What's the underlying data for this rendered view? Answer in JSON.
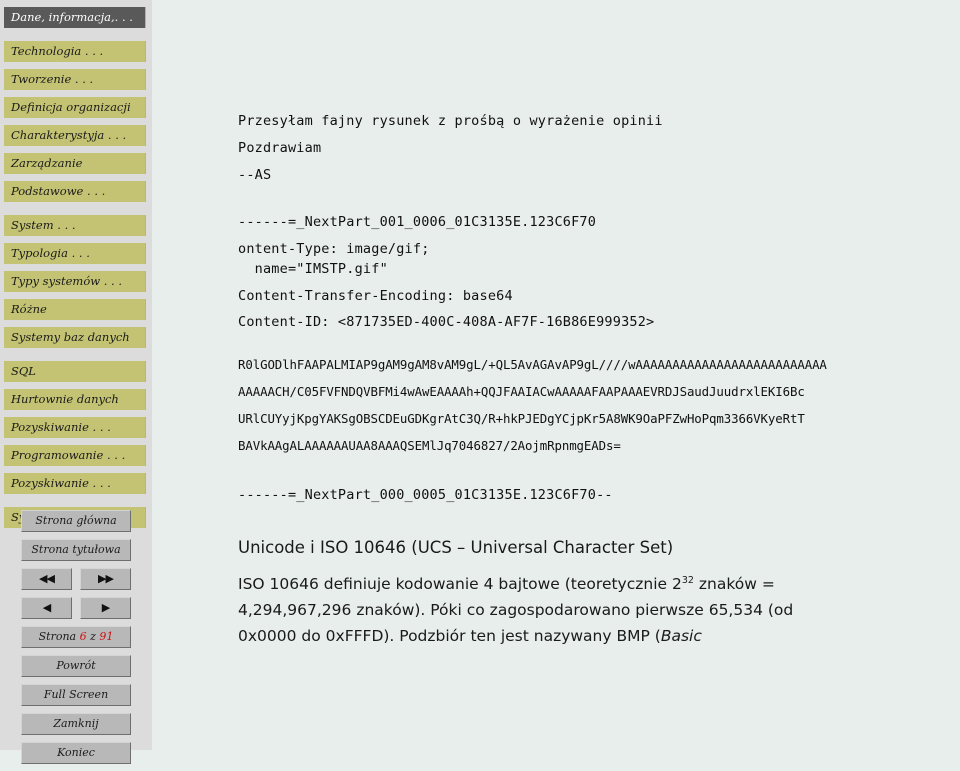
{
  "sidebar": {
    "items": [
      {
        "label": "Dane, informacja,. . .",
        "active": true,
        "gap": "sm"
      },
      {
        "label": "Technologia . . .",
        "active": false,
        "gap": "md"
      },
      {
        "label": "Tworzenie . . .",
        "active": false,
        "gap": "sm"
      },
      {
        "label": "Definicja organizacji",
        "active": false,
        "gap": "sm"
      },
      {
        "label": "Charakterystyja . . .",
        "active": false,
        "gap": "sm"
      },
      {
        "label": "Zarządzanie",
        "active": false,
        "gap": "sm"
      },
      {
        "label": "Podstawowe . . .",
        "active": false,
        "gap": "sm"
      },
      {
        "label": "System . . .",
        "active": false,
        "gap": "md"
      },
      {
        "label": "Typologia . . .",
        "active": false,
        "gap": "sm"
      },
      {
        "label": "Typy systemów . . .",
        "active": false,
        "gap": "sm"
      },
      {
        "label": "Różne",
        "active": false,
        "gap": "sm"
      },
      {
        "label": "Systemy baz danych",
        "active": false,
        "gap": "sm"
      },
      {
        "label": "SQL",
        "active": false,
        "gap": "md"
      },
      {
        "label": "Hurtownie danych",
        "active": false,
        "gap": "sm"
      },
      {
        "label": "Pozyskiwanie . . .",
        "active": false,
        "gap": "sm"
      },
      {
        "label": "Programowanie . . .",
        "active": false,
        "gap": "sm"
      },
      {
        "label": "Pozyskiwanie . . .",
        "active": false,
        "gap": "sm"
      },
      {
        "label": "System . . .",
        "active": false,
        "gap": "md"
      }
    ],
    "controls": {
      "home": "Strona główna",
      "title_page": "Strona tytułowa",
      "first": "◀◀",
      "last": "▶▶",
      "prev": "◀",
      "next": "▶",
      "page_label_pre": "Strona",
      "page_current": "6",
      "page_of": "z",
      "page_total": "91",
      "back": "Powrót",
      "fullscreen": "Full Screen",
      "close": "Zamknij",
      "quit": "Koniec"
    },
    "colors": {
      "nav_bg": "#c4c373",
      "nav_active_bg": "#595959",
      "sidebar_bg": "#dcdcdc",
      "button_bg": "#b8b8b8",
      "page_number": "#cc1111"
    }
  },
  "main": {
    "mail_lines": [
      "Przesyłam fajny rysunek z prośbą o wyrażenie opinii",
      "Pozdrawiam",
      "--AS"
    ],
    "mime_header": [
      "------=_NextPart_001_0006_01C3135E.123C6F70",
      "ontent-Type: image/gif;",
      "  name=\"IMSTP.gif\"",
      "Content-Transfer-Encoding: base64",
      "Content-ID: <871735ED-400C-408A-AF7F-16B86E999352>"
    ],
    "base64_lines": [
      "R0lGODlhFAAPALMIAP9gAM9gAM8vAM9gL/+QL5AvAGAvAP9gL////wAAAAAAAAAAAAAAAAAAAAAAAAAA",
      "AAAAACH/C05FVFNDQVBFMi4wAwEAAAAh+QQJFAAIACwAAAAAFAAPAAAEVRDJSaudJuudrxlEKI6Bc",
      "URlCUYyjKpgYAKSgOBSCDEuGDKgrAtC3Q/R+hkPJEDgYCjpKr5A8WK9OaPFZwHoPqm3366VKyeRtT",
      "BAVkAAgALAAAAAAUAA8AAAQSEMlJq7046827/2AojmRpnmgEADs="
    ],
    "mime_footer": "------=_NextPart_000_0005_01C3135E.123C6F70--",
    "heading": "Unicode i ISO 10646 (UCS – Universal Character Set)",
    "paragraph": {
      "line1_a": "ISO 10646 definiuje kodowanie 4 bajtowe (teoretycznie 2",
      "line1_sup": "32",
      "line1_b": " znaków =",
      "line2": "4,294,967,296 znaków). Póki co zagospodarowano pierwsze 65,534 (od",
      "line3_a": "0x0000 do 0xFFFD). Podzbiór ten jest nazywany BMP (",
      "line3_italic": "Basic"
    }
  }
}
